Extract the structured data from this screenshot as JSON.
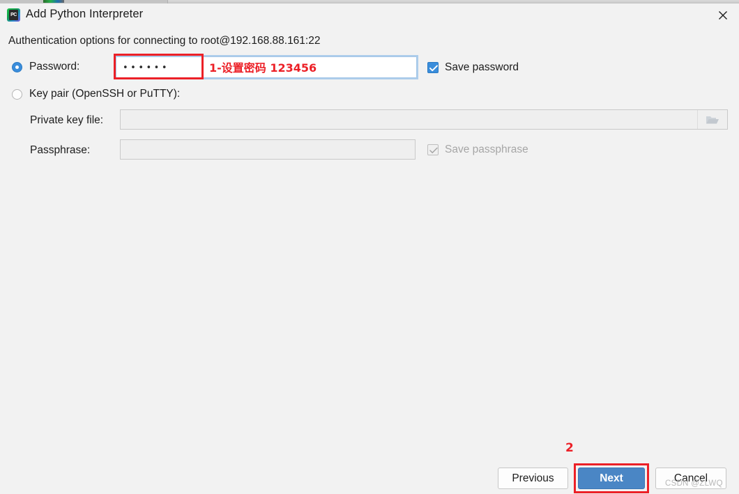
{
  "window": {
    "title": "Add Python Interpreter",
    "app_icon": "pycharm-icon",
    "app_icon_text": "PC",
    "close_icon": "close-icon"
  },
  "form": {
    "subtitle": "Authentication options for connecting to root@192.168.88.161:22",
    "password_option": {
      "label": "Password:",
      "selected": true,
      "value": "••••••",
      "value_length": 6
    },
    "save_password": {
      "label": "Save password",
      "checked": true,
      "enabled": true
    },
    "keypair_option": {
      "label": "Key pair (OpenSSH or PuTTY):",
      "selected": false
    },
    "private_key_file": {
      "label": "Private key file:",
      "value": "",
      "enabled": false,
      "browse_icon": "folder-icon"
    },
    "passphrase": {
      "label": "Passphrase:",
      "value": "",
      "enabled": false
    },
    "save_passphrase": {
      "label": "Save passphrase",
      "checked": true,
      "enabled": false
    }
  },
  "buttons": {
    "previous": "Previous",
    "next": "Next",
    "cancel": "Cancel"
  },
  "annotations": {
    "step1_text": "1-设置密码  123456",
    "step2_text": "2",
    "color": "#ec2027"
  },
  "watermark": "CSDN @ZLWQ",
  "colors": {
    "dialog_bg": "#f2f2f2",
    "accent_blue": "#3a8ddb",
    "primary_button": "#4a86c5",
    "annotation_red": "#ec2027",
    "text": "#1c1c1c",
    "disabled_text": "#a6a6a6"
  }
}
